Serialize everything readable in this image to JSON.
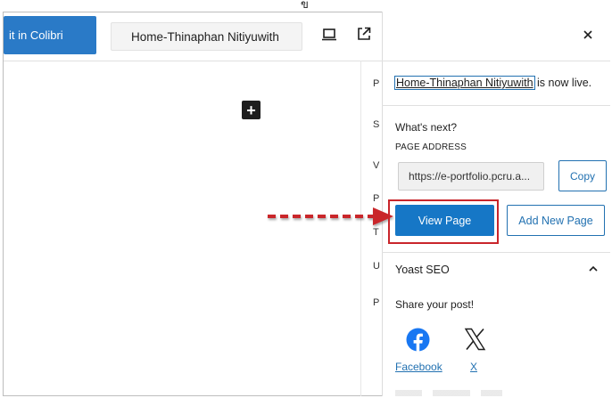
{
  "top_mark": "ข",
  "toolbar": {
    "edit_colibri_label": "it in Colibri",
    "page_title": "Home-Thinaphan Nitiyuwith",
    "preview_icon": "desktop-preview-icon",
    "external_icon": "external-link-icon"
  },
  "canvas": {
    "add_block_icon": "plus-icon",
    "plus_symbol": "+"
  },
  "side_letters": [
    "P",
    "S",
    "V",
    "P",
    "T",
    "U",
    "P"
  ],
  "panel": {
    "close_icon": "close-icon",
    "live_link": "Home-Thinaphan Nitiyuwith",
    "live_suffix": " is now live.",
    "whats_next": "What's next?",
    "page_address_label": "PAGE ADDRESS",
    "url_value": "https://e-portfolio.pcru.a...",
    "copy_label": "Copy",
    "view_page_label": "View Page",
    "add_new_page_label": "Add New Page",
    "yoast_title": "Yoast SEO",
    "share_text": "Share your post!",
    "facebook_label": "Facebook",
    "x_label": "X"
  },
  "colors": {
    "accent": "#2271b1",
    "primary_button": "#1677c6",
    "highlight": "#c9252b"
  }
}
